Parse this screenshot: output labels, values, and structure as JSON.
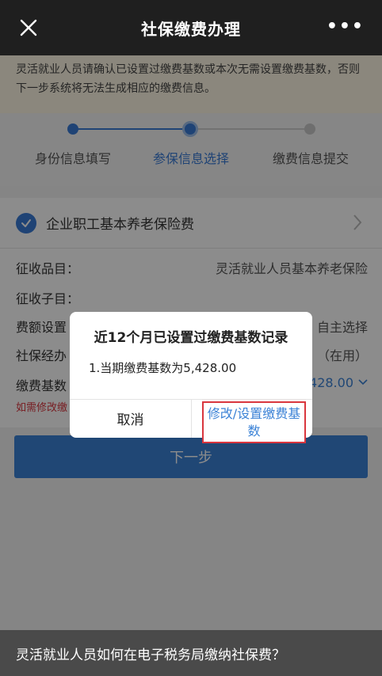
{
  "nav": {
    "title": "社保缴费办理",
    "more": "•••"
  },
  "notice": "灵活就业人员请确认已设置过缴费基数或本次无需设置缴费基数，否则下一步系统将无法生成相应的缴费信息。",
  "steps": [
    {
      "label": "身份信息填写",
      "state": "done"
    },
    {
      "label": "参保信息选择",
      "state": "active"
    },
    {
      "label": "缴费信息提交",
      "state": "todo"
    }
  ],
  "card": {
    "title": "企业职工基本养老保险费",
    "rows": {
      "item": {
        "label": "征收品目：",
        "value": "灵活就业人员基本养老保险"
      },
      "subitem": {
        "label": "征收子目：",
        "value": ""
      },
      "amount_setting": {
        "label": "费额设置",
        "value": "自主选择"
      },
      "agency": {
        "label": "社保经办",
        "value": "（在用）"
      },
      "base": {
        "label": "缴费基数",
        "value": "428.00"
      },
      "hint": "如需修改缴"
    }
  },
  "next_button": "下一步",
  "dialog": {
    "title": "近12个月已设置过缴费基数记录",
    "body": "1.当期缴费基数为5,428.00",
    "cancel": "取消",
    "confirm": "修改/设置缴费基数"
  },
  "banner": "灵活就业人员如何在电子税务局缴纳社保费？",
  "colors": {
    "accent": "#3b82d6",
    "highlight": "#d9363e",
    "notice_bg": "#fdf6e3"
  }
}
